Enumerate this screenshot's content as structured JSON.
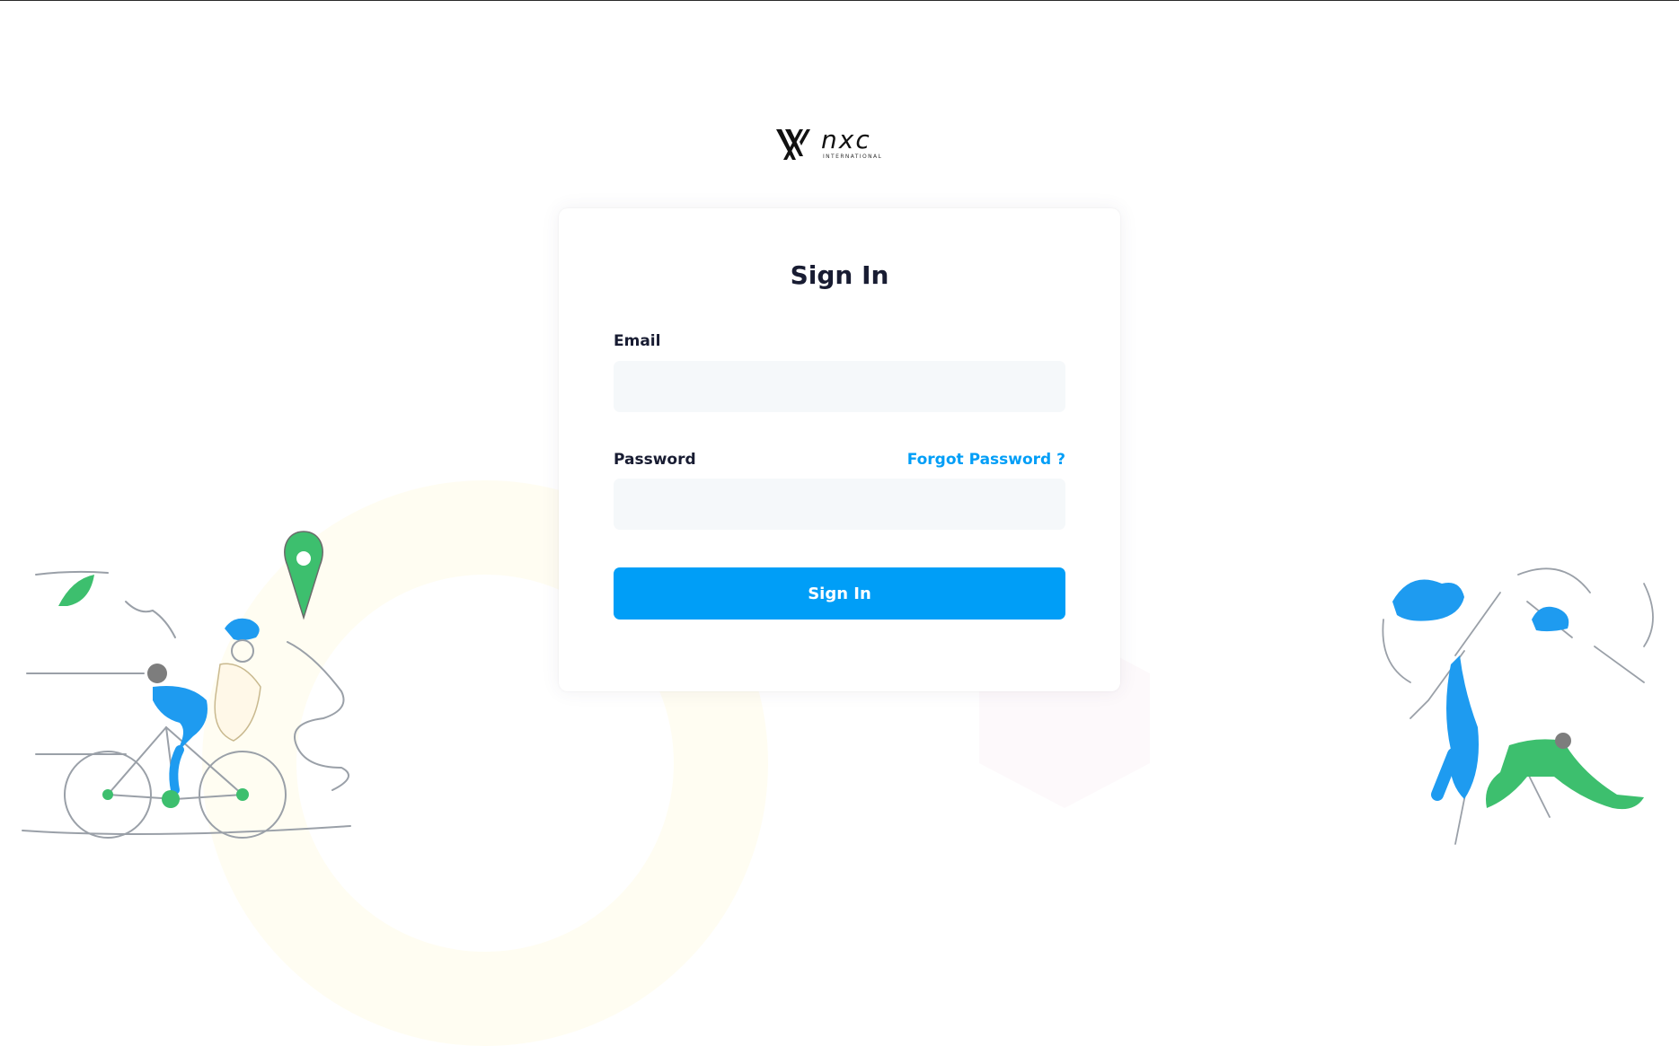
{
  "brand": {
    "name": "nxc",
    "subtitle": "INTERNATIONAL"
  },
  "form": {
    "title": "Sign In",
    "email_label": "Email",
    "email_value": "",
    "password_label": "Password",
    "password_value": "",
    "forgot_password": "Forgot Password ?",
    "submit_label": "Sign In"
  },
  "colors": {
    "primary": "#009ef7",
    "title": "#181c32",
    "input_bg": "#f5f8fa",
    "illustration_blue": "#1e9bf0",
    "illustration_green": "#3dbf6e"
  },
  "icons": {
    "logo": "nxc-logo-icon",
    "left_illustration": "cyclist-illustration",
    "right_illustration": "dancing-people-illustration",
    "map_pin": "map-pin-icon"
  }
}
